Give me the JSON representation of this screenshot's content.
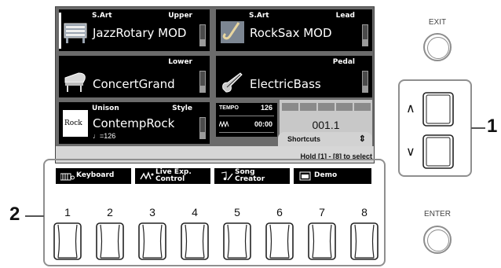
{
  "screen": {
    "panels": [
      {
        "type": "S.Art",
        "part": "Upper",
        "voice": "JazzRotary MOD"
      },
      {
        "type": "S.Art",
        "part": "Lead",
        "voice": "RockSax MOD"
      },
      {
        "type": "",
        "part": "Lower",
        "voice": "ConcertGrand"
      },
      {
        "type": "",
        "part": "Pedal",
        "voice": "ElectricBass"
      },
      {
        "type": "Unison",
        "part": "Style",
        "voice": "ContempRock",
        "tempo_note": "♩=126",
        "logo_text": "Rock"
      }
    ],
    "tempo": {
      "label": "TEMPO",
      "value": "126",
      "metronome_icon": "metronome-icon",
      "time": "00:00"
    },
    "measure": "001.1",
    "shortcuts": {
      "label": "Shortcuts",
      "hint": "Hold [1] - [8] to select"
    },
    "tabs": [
      {
        "label": "Keyboard",
        "icon": "keyboard-icon"
      },
      {
        "label1": "Live Exp.",
        "label2": "Control",
        "icon": "live-exp-icon"
      },
      {
        "label1": "Song",
        "label2": "Creator",
        "icon": "song-creator-icon"
      },
      {
        "label": "Demo",
        "icon": "demo-icon"
      }
    ]
  },
  "buttons": {
    "numbers": [
      "1",
      "2",
      "3",
      "4",
      "5",
      "6",
      "7",
      "8"
    ],
    "callout": "2"
  },
  "right_panel": {
    "exit_label": "EXIT",
    "enter_label": "ENTER",
    "up_arrow": "∧",
    "down_arrow": "∨",
    "callout": "1"
  }
}
